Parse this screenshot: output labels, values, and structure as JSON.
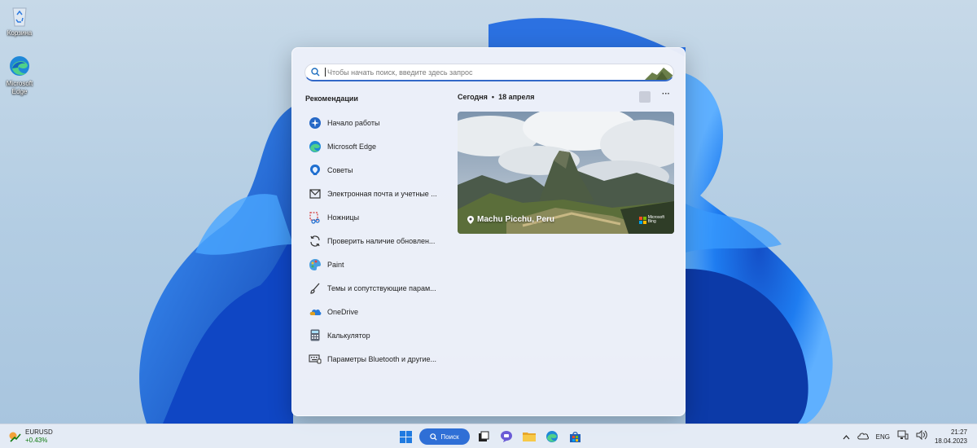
{
  "desktop": {
    "icons": [
      {
        "label": "Корзина"
      },
      {
        "label": "Microsoft Edge"
      }
    ]
  },
  "search": {
    "placeholder": "Чтобы начать поиск, введите здесь запрос"
  },
  "recommendations": {
    "title": "Рекомендации",
    "items": [
      {
        "label": "Начало работы",
        "icon": "get-started-icon"
      },
      {
        "label": "Microsoft Edge",
        "icon": "edge-icon"
      },
      {
        "label": "Советы",
        "icon": "tips-icon"
      },
      {
        "label": "Электронная почта и учетные ...",
        "icon": "mail-icon"
      },
      {
        "label": "Ножницы",
        "icon": "snipping-tool-icon"
      },
      {
        "label": "Проверить наличие обновлен...",
        "icon": "update-icon"
      },
      {
        "label": "Paint",
        "icon": "paint-icon"
      },
      {
        "label": "Темы и сопутствующие парам...",
        "icon": "brush-icon"
      },
      {
        "label": "OneDrive",
        "icon": "onedrive-icon"
      },
      {
        "label": "Калькулятор",
        "icon": "calculator-icon"
      },
      {
        "label": "Параметры Bluetooth и другие...",
        "icon": "bluetooth-settings-icon"
      }
    ]
  },
  "highlights": {
    "today_label": "Сегодня",
    "date": "18 апреля",
    "separator": "•",
    "more": "···",
    "image_caption": "Machu Picchu, Peru",
    "brand_line1": "Microsoft",
    "brand_line2": "Bing"
  },
  "taskbar": {
    "widget_symbol": "EURUSD",
    "widget_change": "+0.43%",
    "search_label": "Поиск",
    "language": "ENG",
    "time": "21:27",
    "date": "18.04.2023"
  },
  "colors": {
    "accent": "#2f6fd6",
    "positive": "#0f7b0f"
  }
}
